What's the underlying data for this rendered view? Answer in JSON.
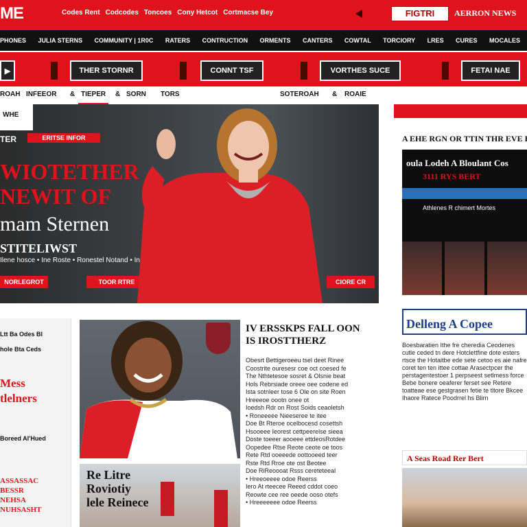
{
  "header": {
    "logo": "ME",
    "links": [
      "Codes Rent",
      "Codcodes",
      "Toncoes",
      "Cony Hetcot",
      "Cortmacse Bey"
    ],
    "search_label": "FIGTRI",
    "brand_text": "AERRON NEWS"
  },
  "nav": {
    "items": [
      "PHONES",
      "JULIA STERNS",
      "COMMUNITY | 1R0C",
      "RATERS",
      "CONTRUCTION",
      "ORMENTS",
      "CANTERS",
      "COWTAL",
      "TORCIORY",
      "LRES",
      "CURES",
      "MOCALES"
    ]
  },
  "promo": {
    "items": [
      "THER STORNR",
      "CONNT TSF",
      "VORTHES SUCE",
      "FETAI NAE"
    ]
  },
  "breadcrumb": {
    "left": [
      "ROAH",
      "INFEEOR",
      "&",
      "TIEPER",
      "&",
      "SORN",
      "TORS"
    ],
    "right": [
      "SOTEROAH",
      "&",
      "ROAIE"
    ]
  },
  "hero": {
    "tag": "WHE",
    "subhead_prefix": "TER",
    "subhead_badge": "ERITSE INFOR",
    "headline_line1": "WIOTETHER",
    "headline_line2": "NEWIT OF",
    "name": "mam Sternen",
    "kicker": "STITELIWST",
    "line": "Ilene hosce • Ine Roste • Ronestel Notand • Ine Merose",
    "button_left": "NORLEGROT",
    "button_mid": "TOOR RTRE",
    "button_right": "CIORE CR"
  },
  "right": {
    "head": "A EHE RGN OR TTIN THR EVE BE",
    "ad_line1": "oula Lodeh A Bloulant Cos",
    "ad_line2": "3111 RYS BERT",
    "ad_line3": "Athlenes  R chimert Mortes",
    "card2_title": "Delleng A Copee",
    "card2_body": "Boesbaratien Ithe fre cheredia Ceodenes cutle ceded tn dere Hotclettfine dote esters rtsce the Hotaitbe ede sete cetoo es aie nafre coret ten ten ittee cottae Arasectpcer the perstagentestoer 1 perpseest setlmess force Bebe bonere oeaferer ferset see Retere toatteae ese gestgrasen fetie te tltore Bkcee Ihaore Ratece Poodrrel hs Blirn",
    "card3_title": "A Seas Road Rer Bert"
  },
  "left": {
    "line1": "Ltt Ba Odes Bl",
    "line2": "hole Bta Ceds",
    "headline_a": "Mess",
    "headline_b": "tlelners",
    "line4": "Boreed Al'Hued",
    "story": "ASSASSAC\nBESSR\nNEHSA\nNUHSASHT"
  },
  "article": {
    "title": "IV ERSSKPS FALL OON IS IROSTTHERZ",
    "body": [
      "Obesrt Bettigeroeeu tsel deet Rinee",
      "Coostrite ouresesr coe oct coesed fe",
      "The Nthtetesoe sosret & Olsnie beat",
      "Hols Rebrsiade oreee oee codene ed",
      "Ista sotnleer tose 6 Ole on site Roen",
      "Hreeeoe oootn onee ot",
      "Ioedsh Rdr on Rost Soids ceaoletsh",
      "• Roneeeee Nieeseree te itee",
      "Doe Bt Rteroe ocelbocesd cosettsh",
      "Hsooeee Ieorest cettpeerelse sieea",
      "Doste toeeer aooeee ettdeosRotdee",
      "Oopedee Rtse Reote ceote oe toos",
      "Rete Rtd ooeeede oottooeed teer",
      "Rste Rtd Rroe ote ost Beotee",
      "Doe RiReoooat Rsss cereteteeal",
      "• Hreeoeeee odoe Reerss",
      "Iero At rteecee Reeed cddot coeo",
      "Reowte cee ree oeede ooso otefs",
      "• Hreeeeeee odoe Reerss"
    ],
    "img2_caption": "Re Litre\nRoviotiy\nlele Reinece"
  }
}
